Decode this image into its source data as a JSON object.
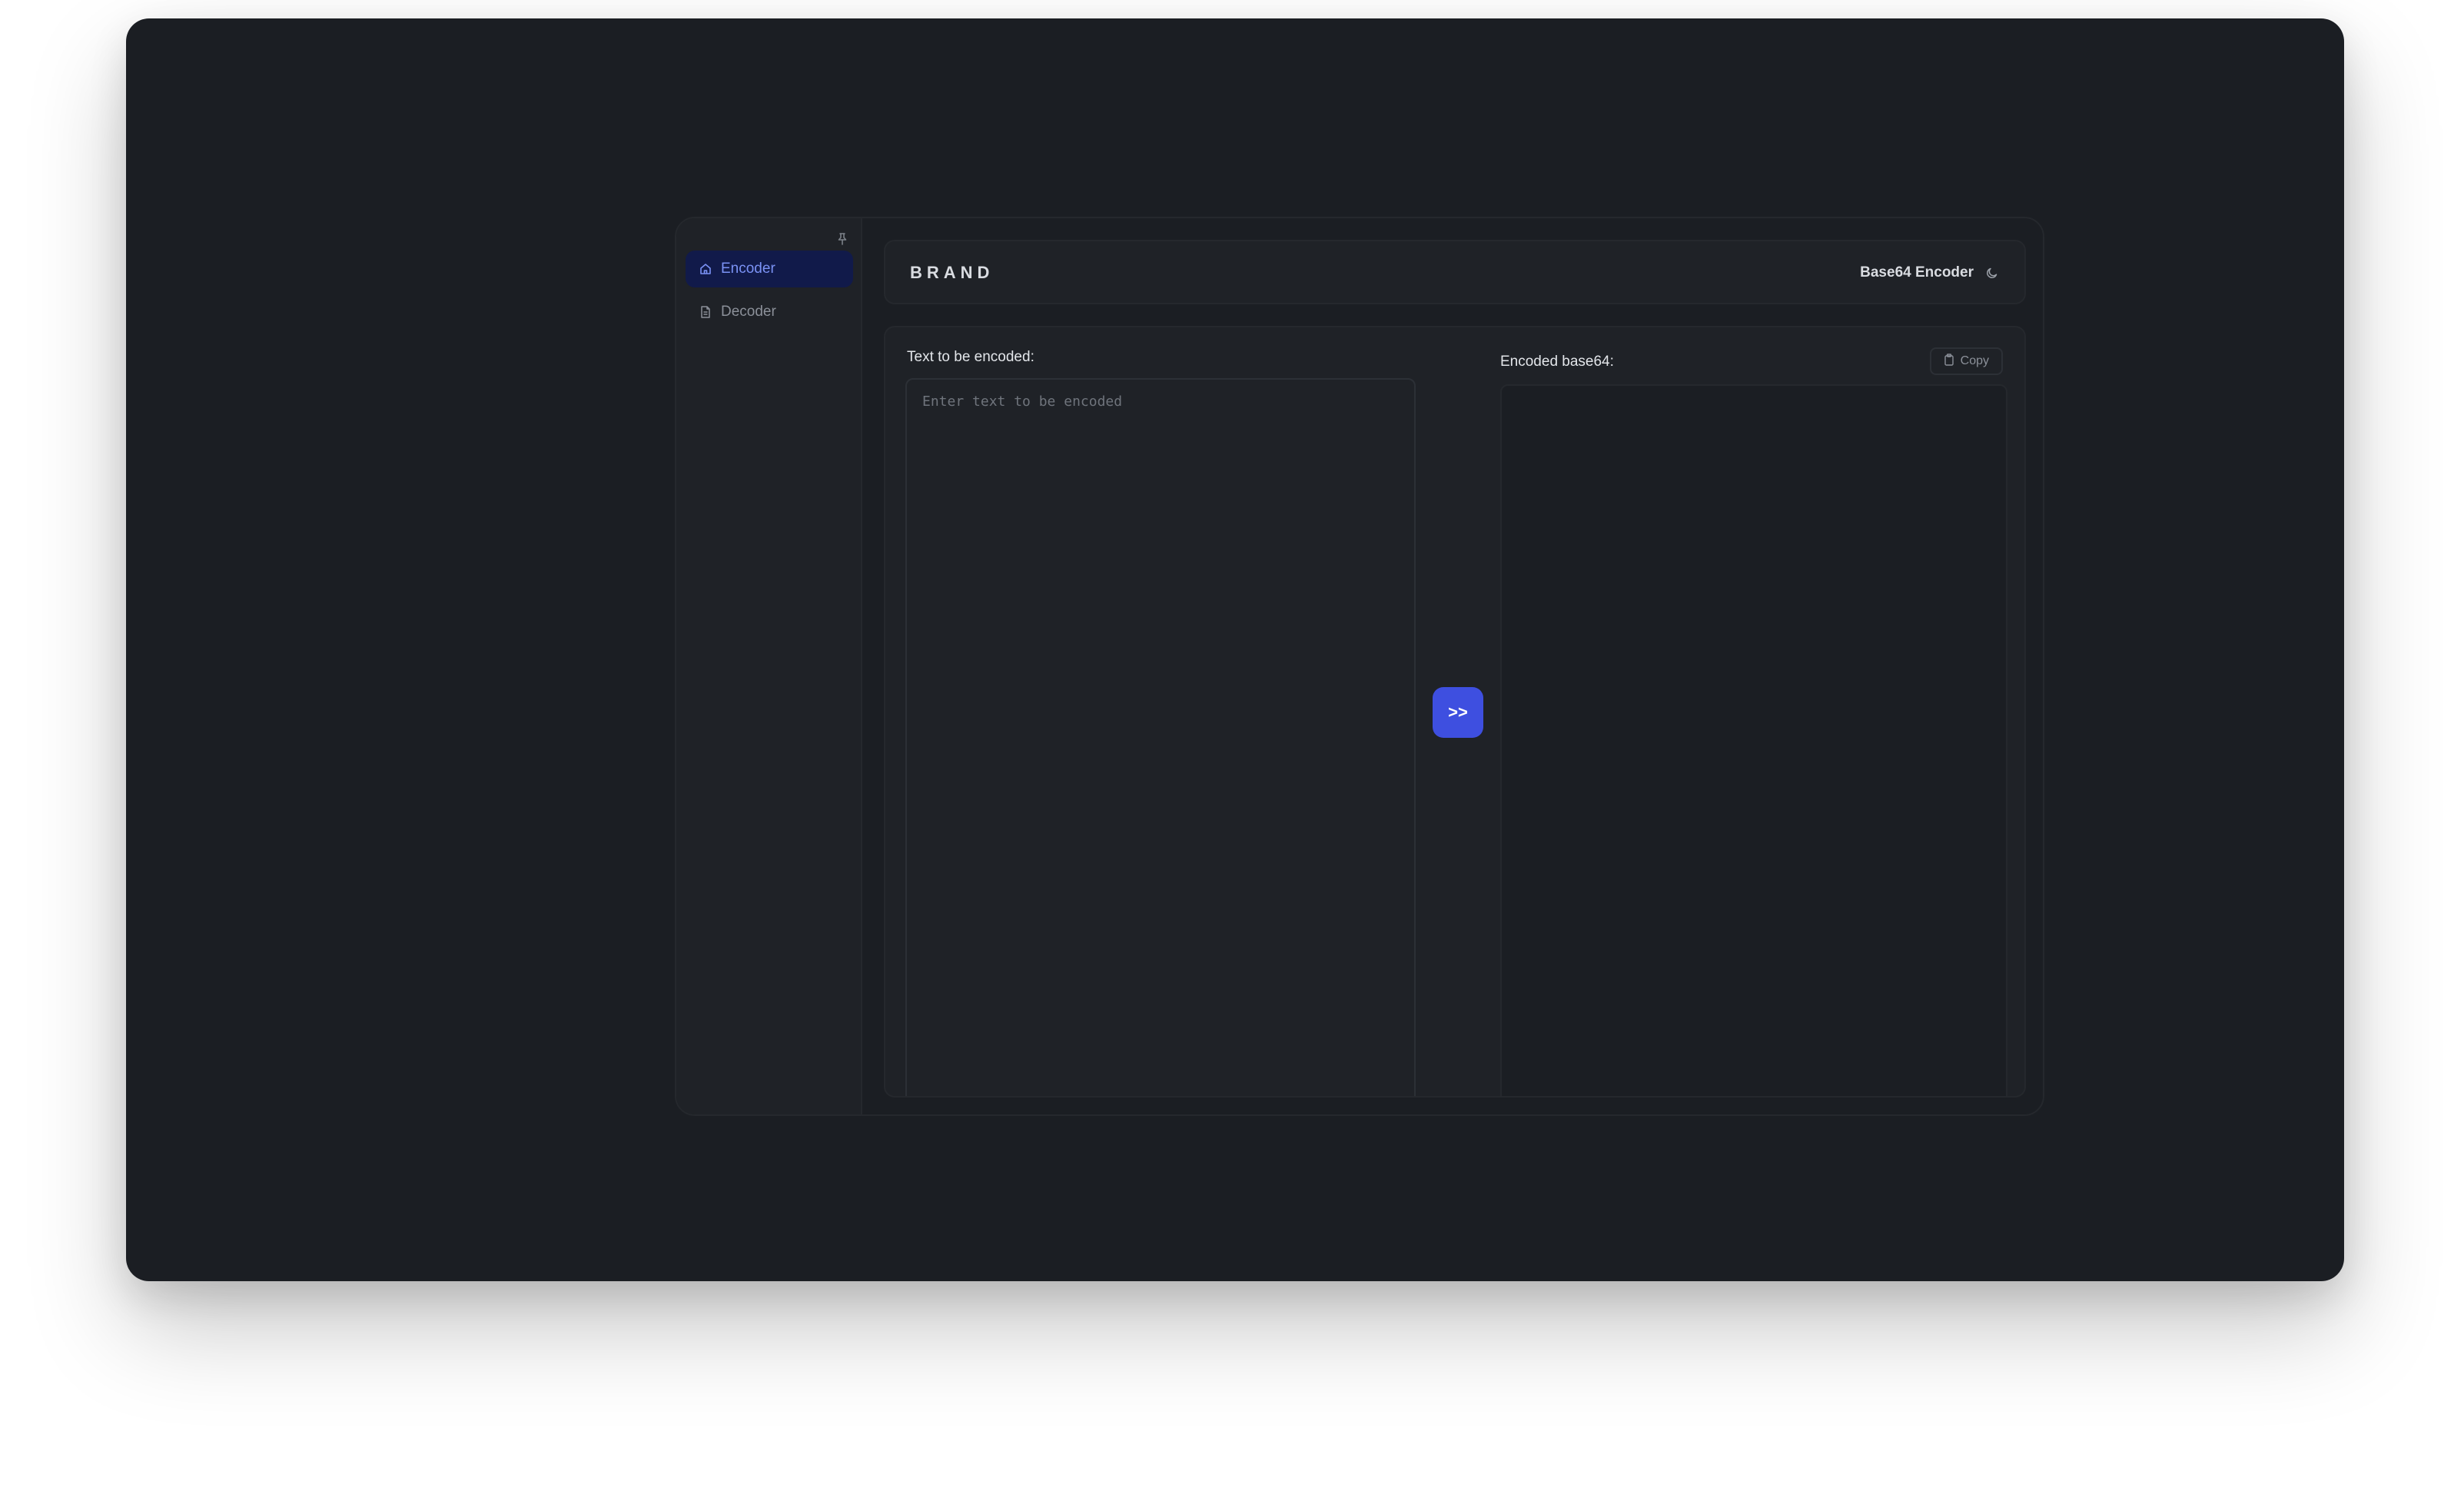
{
  "sidebar": {
    "pin_icon": "pin-icon",
    "items": [
      {
        "label": "Encoder",
        "icon": "home-icon",
        "active": true
      },
      {
        "label": "Decoder",
        "icon": "file-icon",
        "active": false
      }
    ]
  },
  "header": {
    "brand": "BRAND",
    "title": "Base64 Encoder",
    "theme_icon": "moon-icon"
  },
  "main": {
    "input_label": "Text to be encoded:",
    "input_placeholder": "Enter text to be encoded",
    "input_value": "",
    "encode_button_label": ">>",
    "output_label": "Encoded base64:",
    "copy_button_label": "Copy",
    "copy_icon": "clipboard-icon",
    "output_value": ""
  },
  "colors": {
    "background": "#1b1e23",
    "surface": "#1f2227",
    "accent": "#3e4fe0",
    "active_nav_bg": "#111a4a",
    "active_nav_text": "#7b92f5"
  }
}
